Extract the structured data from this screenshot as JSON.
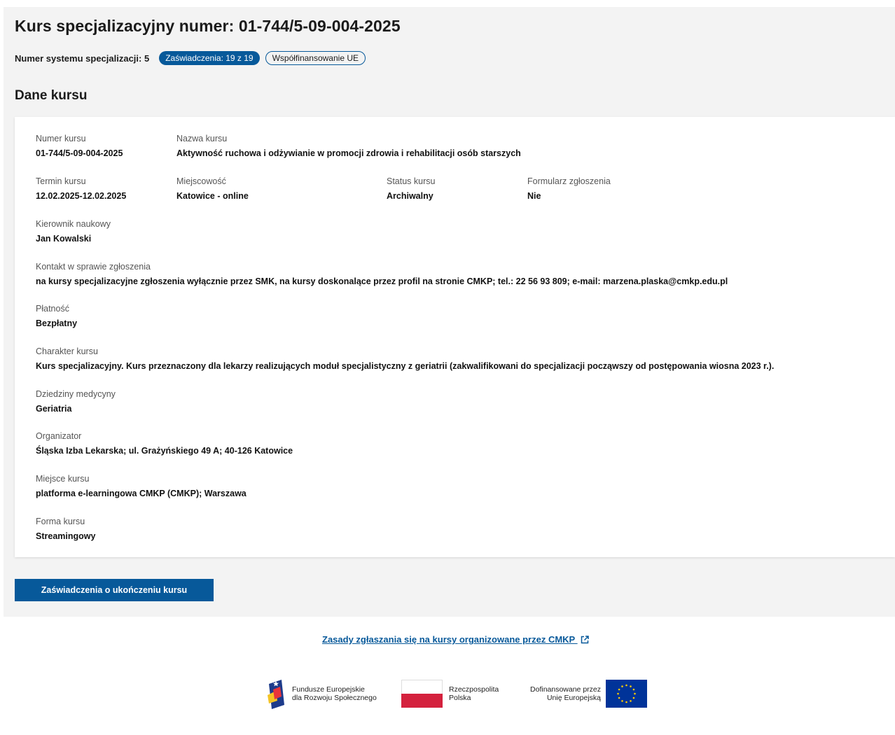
{
  "header": {
    "title": "Kurs specjalizacyjny numer: 01-744/5-09-004-2025",
    "system_label": "Numer systemu specjalizacji: 5",
    "badge_certificates": "Zaświadczenia: 19 z 19",
    "badge_cofinancing": "Współfinansowanie UE"
  },
  "section": {
    "title": "Dane kursu"
  },
  "fields": {
    "numer_kursu": {
      "label": "Numer kursu",
      "value": "01-744/5-09-004-2025"
    },
    "nazwa_kursu": {
      "label": "Nazwa kursu",
      "value": "Aktywność ruchowa i odżywianie w promocji zdrowia i rehabilitacji osób starszych"
    },
    "termin_kursu": {
      "label": "Termin kursu",
      "value": "12.02.2025-12.02.2025"
    },
    "miejscowosc": {
      "label": "Miejscowość",
      "value": "Katowice - online"
    },
    "status_kursu": {
      "label": "Status kursu",
      "value": "Archiwalny"
    },
    "formularz": {
      "label": "Formularz zgłoszenia",
      "value": "Nie"
    },
    "kierownik": {
      "label": "Kierownik naukowy",
      "value": "Jan Kowalski"
    },
    "kontakt": {
      "label": "Kontakt w sprawie zgłoszenia",
      "value": "na kursy specjalizacyjne zgłoszenia wyłącznie przez SMK, na kursy doskonalące przez profil na stronie CMKP; tel.: 22 56 93 809; e-mail: marzena.plaska@cmkp.edu.pl"
    },
    "platnosc": {
      "label": "Płatność",
      "value": "Bezpłatny"
    },
    "charakter": {
      "label": "Charakter kursu",
      "value": "Kurs specjalizacyjny. Kurs przeznaczony dla lekarzy realizujących moduł specjalistyczny z geriatrii (zakwalifikowani do specjalizacji począwszy od postępowania wiosna 2023 r.)."
    },
    "dziedziny": {
      "label": "Dziedziny medycyny",
      "value": "Geriatria"
    },
    "organizator": {
      "label": "Organizator",
      "value": "Śląska Izba Lekarska; ul. Grażyńskiego 49 A; 40-126 Katowice"
    },
    "miejsce": {
      "label": "Miejsce kursu",
      "value": "platforma e-learningowa CMKP (CMKP); Warszawa"
    },
    "forma": {
      "label": "Forma kursu",
      "value": "Streamingowy"
    }
  },
  "actions": {
    "certificates_button": "Zaświadczenia o ukończeniu kursu"
  },
  "footer": {
    "rules_link": "Zasady zgłaszania się na kursy organizowane przez CMKP",
    "logo_fe_line1": "Fundusze Europejskie",
    "logo_fe_line2": "dla Rozwoju Społecznego",
    "logo_rp_line1": "Rzeczpospolita",
    "logo_rp_line2": "Polska",
    "logo_ue_line1": "Dofinansowane przez",
    "logo_ue_line2": "Unię Europejską"
  },
  "colors": {
    "accent": "#07599a",
    "background": "#f3f3f3",
    "card": "#ffffff"
  }
}
